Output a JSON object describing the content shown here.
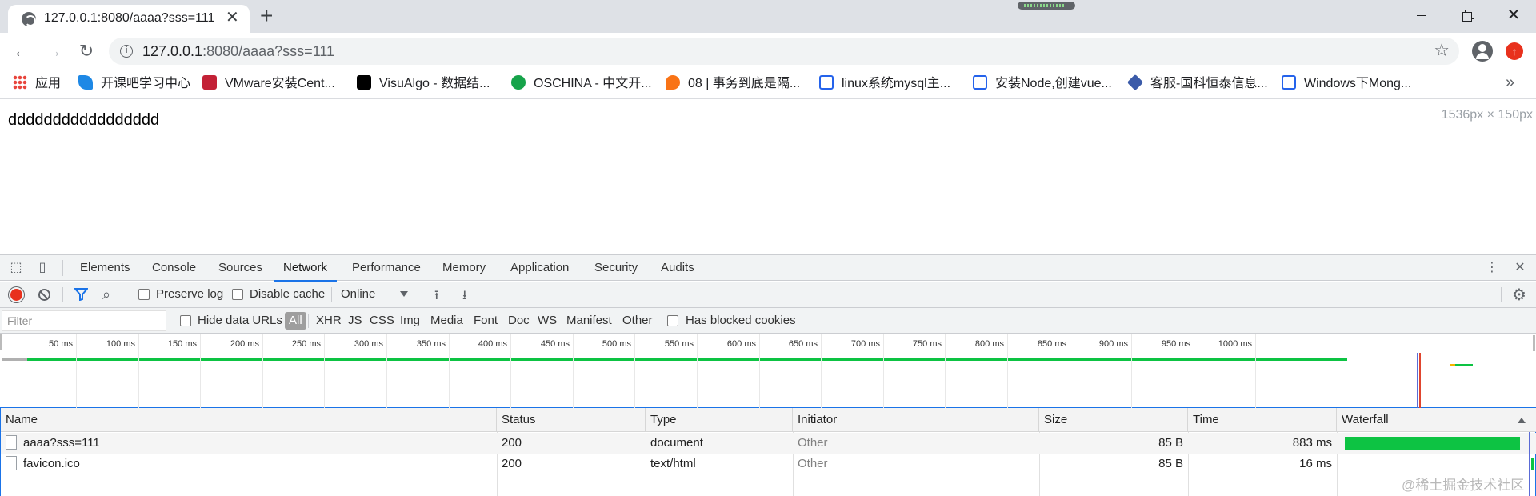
{
  "tab": {
    "title": "127.0.0.1:8080/aaaa?sss=111",
    "close": "✕",
    "new_tab": "+"
  },
  "omnibox": {
    "url_host": "127.0.0.1",
    "url_rest": ":8080/aaaa?sss=111"
  },
  "bookmarks": [
    {
      "label": "应用",
      "icon": "apps-icon",
      "color": "#e8453c"
    },
    {
      "label": "开课吧学习中心",
      "icon": "kaikeba-icon",
      "color": "#1e88e5"
    },
    {
      "label": "VMware安装Cent...",
      "icon": "csdn-icon",
      "color": "#c32136"
    },
    {
      "label": "VisuAlgo - 数据结...",
      "icon": "visualgo-icon",
      "color": "#000000"
    },
    {
      "label": "OSCHINA - 中文开...",
      "icon": "oschina-icon",
      "color": "#16a34a"
    },
    {
      "label": "08 | 事务到底是隔...",
      "icon": "geektime-icon",
      "color": "#f97316"
    },
    {
      "label": "linux系统mysql主...",
      "icon": "blog-icon",
      "color": "#2563eb"
    },
    {
      "label": "安装Node,创建vue...",
      "icon": "blog-icon",
      "color": "#2563eb"
    },
    {
      "label": "客服-国科恒泰信息...",
      "icon": "cube-icon",
      "color": "#3b5ba9"
    },
    {
      "label": "Windows下Mong...",
      "icon": "blog-icon",
      "color": "#2563eb"
    }
  ],
  "bookmarks_more": "»",
  "page": {
    "text": "ddddddddddddddddd",
    "dimensions": "1536px × 150px"
  },
  "devtools": {
    "tabs": [
      "Elements",
      "Console",
      "Sources",
      "Network",
      "Performance",
      "Memory",
      "Application",
      "Security",
      "Audits"
    ],
    "active_tab": "Network",
    "preserve_log": "Preserve log",
    "disable_cache": "Disable cache",
    "throttle": "Online",
    "filter_placeholder": "Filter",
    "hide_data_urls": "Hide data URLs",
    "types": [
      "All",
      "XHR",
      "JS",
      "CSS",
      "Img",
      "Media",
      "Font",
      "Doc",
      "WS",
      "Manifest",
      "Other"
    ],
    "has_blocked_cookies": "Has blocked cookies",
    "timeline_labels": [
      "50 ms",
      "100 ms",
      "150 ms",
      "200 ms",
      "250 ms",
      "300 ms",
      "350 ms",
      "400 ms",
      "450 ms",
      "500 ms",
      "550 ms",
      "600 ms",
      "650 ms",
      "700 ms",
      "750 ms",
      "800 ms",
      "850 ms",
      "900 ms",
      "950 ms",
      "1000 ms"
    ],
    "columns": [
      "Name",
      "Status",
      "Type",
      "Initiator",
      "Size",
      "Time",
      "Waterfall"
    ],
    "rows": [
      {
        "name": "aaaa?sss=111",
        "status": "200",
        "type": "document",
        "initiator": "Other",
        "size": "85 B",
        "time": "883 ms",
        "duration_ms": 883
      },
      {
        "name": "favicon.ico",
        "status": "200",
        "type": "text/html",
        "initiator": "Other",
        "size": "85 B",
        "time": "16 ms",
        "duration_ms": 16
      }
    ],
    "accent_color": "#1a73e8",
    "bar_color": "#0dc343"
  },
  "watermark": "@稀土掘金技术社区"
}
